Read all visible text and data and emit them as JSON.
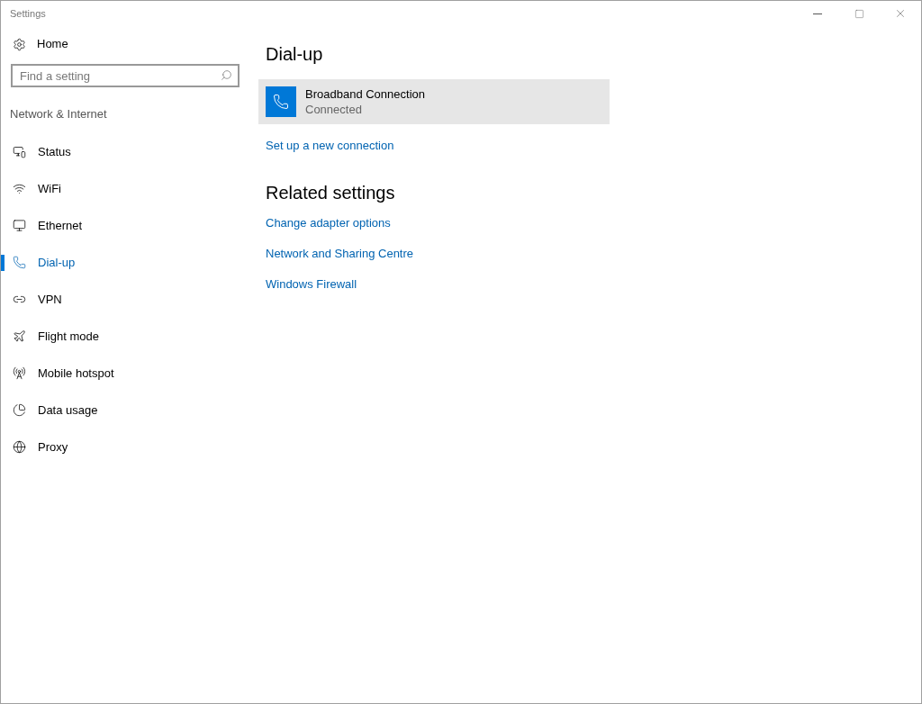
{
  "window": {
    "title": "Settings"
  },
  "sidebar": {
    "home": "Home",
    "search": {
      "placeholder": "Find a setting"
    },
    "section": "Network & Internet",
    "items": [
      {
        "label": "Status",
        "kind": "status",
        "selected": false
      },
      {
        "label": "WiFi",
        "kind": "wifi",
        "selected": false
      },
      {
        "label": "Ethernet",
        "kind": "ethernet",
        "selected": false
      },
      {
        "label": "Dial-up",
        "kind": "dialup",
        "selected": true
      },
      {
        "label": "VPN",
        "kind": "vpn",
        "selected": false
      },
      {
        "label": "Flight mode",
        "kind": "flight",
        "selected": false
      },
      {
        "label": "Mobile hotspot",
        "kind": "hotspot",
        "selected": false
      },
      {
        "label": "Data usage",
        "kind": "data",
        "selected": false
      },
      {
        "label": "Proxy",
        "kind": "proxy",
        "selected": false
      }
    ]
  },
  "content": {
    "title": "Dial-up",
    "connection": {
      "name": "Broadband Connection",
      "status": "Connected"
    },
    "setup_link": "Set up a new connection",
    "related_title": "Related settings",
    "related_links": [
      "Change adapter options",
      "Network and Sharing Centre",
      "Windows Firewall"
    ]
  }
}
